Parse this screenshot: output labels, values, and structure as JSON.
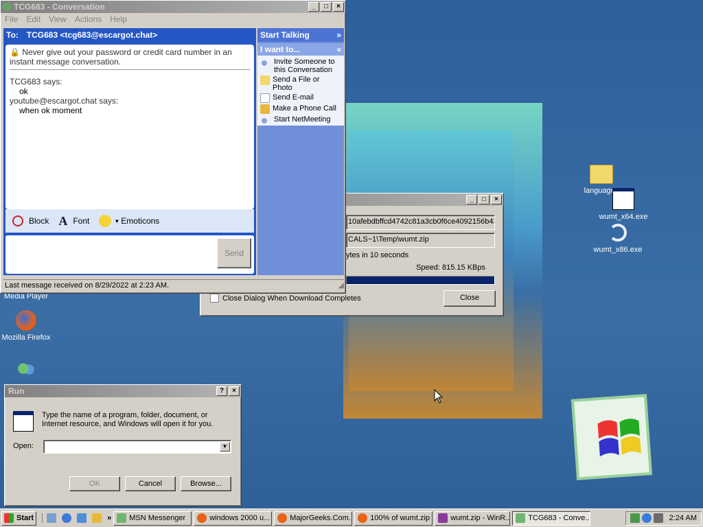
{
  "desktop": {
    "icons": [
      {
        "label": "Media Player"
      },
      {
        "label": "Mozilla Firefox"
      },
      {
        "label": "languages"
      },
      {
        "label": "wumt_x64.exe"
      },
      {
        "label": "wumt_x86.exe"
      }
    ]
  },
  "msn": {
    "title": "TCG683 - Conversation",
    "menu": [
      "File",
      "Edit",
      "View",
      "Actions",
      "Help"
    ],
    "to_label": "To:",
    "to_value": "TCG683 <tcg683@escargot.chat>",
    "warning": "Never give out your password or credit card number in an instant message conversation.",
    "messages": [
      {
        "sender": "TCG683 says:",
        "text": "ok"
      },
      {
        "sender": "youtube@escargot.chat says:",
        "text": "when ok moment"
      }
    ],
    "toolbar": {
      "block": "Block",
      "font": "Font",
      "emoticons": "Emoticons"
    },
    "send": "Send",
    "status": "Last message received on 8/29/2022 at 2:23 AM.",
    "side": {
      "start_talking": "Start Talking",
      "i_want_to": "I want to...",
      "items": [
        "Invite Someone to this Conversation",
        "Send a File or Photo",
        "Send E-mail",
        "Make a Phone Call",
        "Start NetMeeting"
      ]
    }
  },
  "download": {
    "hash": "10afebdbffcd4742c81a3cb0f6ce4092156b43",
    "path": "CALS~1\\Temp\\wumt.zip",
    "bytes_text": "ytes in 10 seconds",
    "speed": "Speed: 815.15 KBps",
    "progress": 1.0,
    "checkbox_label": "Close Dialog When Download Completes",
    "close": "Close"
  },
  "run": {
    "title": "Run",
    "description": "Type the name of a program, folder, document, or Internet resource, and Windows will open it for you.",
    "open_label": "Open:",
    "open_value": "",
    "ok": "OK",
    "cancel": "Cancel",
    "browse": "Browse..."
  },
  "taskbar": {
    "start": "Start",
    "items": [
      "MSN Messenger",
      "windows 2000 u...",
      "MajorGeeks.Com...",
      "100% of wumt.zip",
      "wumt.zip - WinR...",
      "TCG683 - Conve..."
    ],
    "clock": "2:24 AM"
  },
  "colors": {
    "titlebar_active": "#0a246a",
    "msn_blue": "#2457c4",
    "desktop": "#3a6ea5"
  }
}
